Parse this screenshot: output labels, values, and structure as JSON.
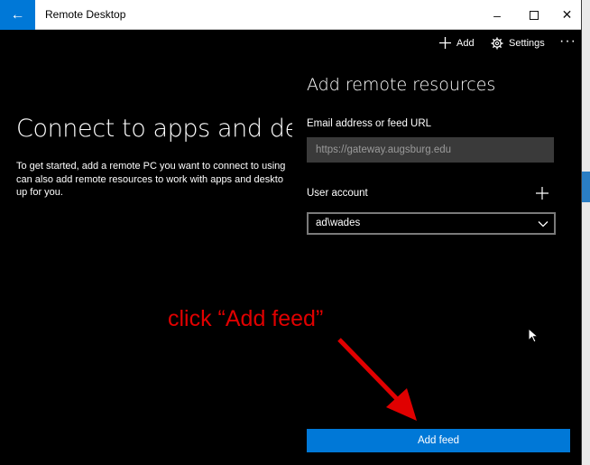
{
  "window": {
    "title": "Remote Desktop",
    "back_glyph": "←",
    "min_glyph": "–",
    "max_glyph": "☐",
    "close_glyph": "✕"
  },
  "topbar": {
    "add_label": "Add",
    "settings_label": "Settings",
    "more_glyph": "···"
  },
  "main": {
    "heading": "Connect to apps and deskt",
    "description_lines": [
      "To get started, add a remote PC you want to connect to using",
      "can also add remote resources to work with apps and deskto",
      "up for you."
    ]
  },
  "panel": {
    "heading": "Add remote resources",
    "email_label": "Email address or feed URL",
    "email_value": "https://gateway.augsburg.edu",
    "user_label": "User account",
    "user_value": "ad\\wades",
    "add_feed_label": "Add feed"
  },
  "annotation": {
    "text": "click “Add feed”",
    "color": "#e00000"
  },
  "colors": {
    "accent": "#0078d7",
    "background": "#000000",
    "input_bg": "#3a3a3a"
  },
  "icons": {
    "back": "arrow-left-icon",
    "add": "plus-icon",
    "settings": "gear-icon",
    "more": "ellipsis-icon",
    "dropdown": "chevron-down-icon"
  }
}
